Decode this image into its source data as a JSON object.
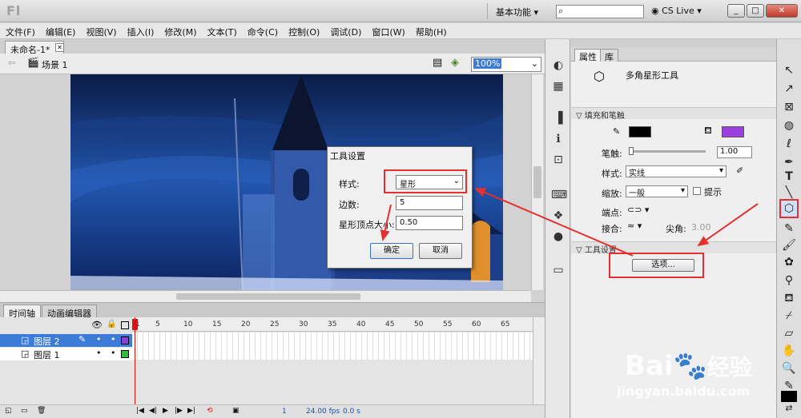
{
  "app": {
    "logo": "Fl",
    "workspace": "基本功能",
    "search_value": "",
    "cs_live": "CS Live",
    "win_buttons": [
      "_",
      "□",
      "✕"
    ]
  },
  "menu": [
    "文件(F)",
    "编辑(E)",
    "视图(V)",
    "插入(I)",
    "修改(M)",
    "文本(T)",
    "命令(C)",
    "控制(O)",
    "调试(D)",
    "窗口(W)",
    "帮助(H)"
  ],
  "document": {
    "tab": "未命名-1*",
    "scene": "场景 1",
    "zoom": "100%"
  },
  "timeline": {
    "tabs": [
      "时间轴",
      "动画编辑器"
    ],
    "ruler": [
      "1",
      "5",
      "10",
      "15",
      "20",
      "25",
      "30",
      "35",
      "40",
      "45",
      "50",
      "55",
      "60",
      "65"
    ],
    "layers": [
      {
        "name": "图层 2",
        "color": "#8a3fd6"
      },
      {
        "name": "图层 1",
        "color": "#2fbf3a"
      }
    ],
    "status": {
      "frame": "1",
      "fps": "24.00 fps",
      "time": "0.0 s"
    }
  },
  "properties": {
    "tabs": [
      "属性",
      "库"
    ],
    "tool_name": "多角星形工具",
    "fill_stroke_header": "填充和笔触",
    "stroke_color": "#000000",
    "fill_color": "#9b3fe0",
    "stroke_label": "笔触:",
    "stroke_value": "1.00",
    "style_label": "样式:",
    "style_value": "实线",
    "scale_label": "缩放:",
    "scale_value": "一般",
    "hint_label": "提示",
    "cap_label": "端点:",
    "join_label": "接合:",
    "miter_label": "尖角:",
    "miter_value": "3.00",
    "tool_settings_header": "工具设置",
    "options_button": "选项..."
  },
  "dialog": {
    "title": "工具设置",
    "style_label": "样式:",
    "style_value": "星形",
    "sides_label": "边数:",
    "sides_value": "5",
    "point_label": "星形顶点大小:",
    "point_value": "0.50",
    "ok": "确定",
    "cancel": "取消"
  },
  "watermark": {
    "brand": "Bai",
    "brand2": "经验",
    "url": "jingyan.baidu.com"
  }
}
